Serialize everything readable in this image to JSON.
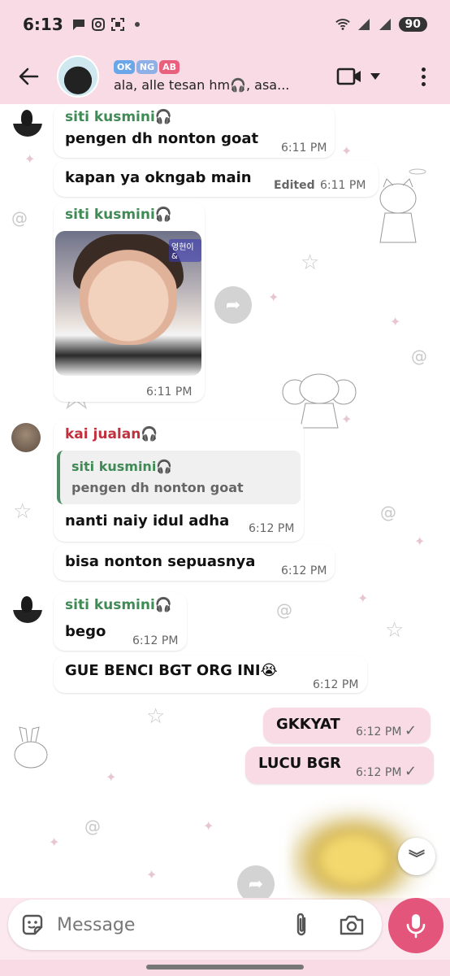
{
  "status_bar": {
    "time": "6:13",
    "battery": "90"
  },
  "header": {
    "badges": [
      {
        "label": "OK",
        "color": "#6aa7e8"
      },
      {
        "label": "NG",
        "color": "#8fb0e6"
      },
      {
        "label": "AB",
        "color": "#e8607e"
      }
    ],
    "subtitle": "ala, alle tesan hm🎧, asa..."
  },
  "messages": [
    {
      "sender": "siti kusmini🎧",
      "text": "pengen dh nonton goat",
      "time": "6:11 PM"
    },
    {
      "text": "kapan ya okngab main",
      "edited": "Edited",
      "time": "6:11 PM"
    },
    {
      "sender": "siti kusmini🎧",
      "photo_label": "영현이&",
      "time": "6:11 PM"
    },
    {
      "sender": "kai jualan🎧",
      "reply_sender": "siti kusmini🎧",
      "reply_text": "pengen dh nonton goat",
      "text": "nanti naiy idul adha",
      "time": "6:12 PM"
    },
    {
      "text": "bisa nonton sepuasnya",
      "time": "6:12 PM"
    },
    {
      "sender": "siti kusmini🎧",
      "text": "bego",
      "time": "6:12 PM"
    },
    {
      "text": "GUE BENCI BGT ORG INI😭",
      "time": "6:12 PM"
    }
  ],
  "outgoing": [
    {
      "text": "GKKYAT",
      "time": "6:12 PM",
      "status": "✓"
    },
    {
      "text": "LUCU BGR",
      "time": "6:12 PM",
      "status": "✓"
    }
  ],
  "colors": {
    "siti": "#3f8a55",
    "kai": "#c0303d",
    "accent": "#e3557b",
    "header_bg": "#f8dbe5"
  },
  "composer": {
    "placeholder": "Message"
  },
  "icons": [
    "back-arrow-icon",
    "video-call-icon",
    "more-vert-icon",
    "forward-icon",
    "chevron-double-down-icon",
    "sticker-icon",
    "paperclip-icon",
    "camera-icon",
    "mic-icon"
  ]
}
